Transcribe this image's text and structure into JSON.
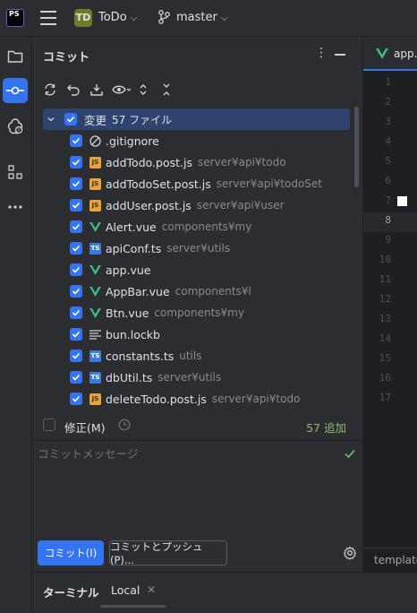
{
  "app": {
    "logo_text": "PS"
  },
  "titlebar": {
    "project_badge": "TD",
    "project_name": "ToDo",
    "branch": "master",
    "caret": "⌵"
  },
  "sidebar_strip": {
    "items": [
      {
        "name": "project-icon"
      },
      {
        "name": "commit-icon",
        "active": true
      },
      {
        "name": "ai-assistant-icon"
      },
      {
        "name": "structure-icon"
      },
      {
        "name": "more-icon"
      }
    ]
  },
  "commit_panel": {
    "title": "コミット",
    "menu_glyph": "⋮",
    "group": {
      "label": "変更",
      "count_text": "57 ファイル"
    },
    "files": [
      {
        "name": ".gitignore",
        "path": "",
        "icon": "ignore-icon"
      },
      {
        "name": "addTodo.post.js",
        "path": "server¥api¥todo",
        "icon": "js-icon"
      },
      {
        "name": "addTodoSet.post.js",
        "path": "server¥api¥todoSet",
        "icon": "js-icon"
      },
      {
        "name": "addUser.post.js",
        "path": "server¥api¥user",
        "icon": "js-icon"
      },
      {
        "name": "Alert.vue",
        "path": "components¥my",
        "icon": "vue-icon"
      },
      {
        "name": "apiConf.ts",
        "path": "server¥utils",
        "icon": "ts-icon"
      },
      {
        "name": "app.vue",
        "path": "",
        "icon": "vue-icon"
      },
      {
        "name": "AppBar.vue",
        "path": "components¥l",
        "icon": "vue-icon"
      },
      {
        "name": "Btn.vue",
        "path": "components¥my",
        "icon": "vue-icon"
      },
      {
        "name": "bun.lockb",
        "path": "",
        "icon": "text-file-icon"
      },
      {
        "name": "constants.ts",
        "path": "utils",
        "icon": "ts-icon"
      },
      {
        "name": "dbUtil.ts",
        "path": "server¥utils",
        "icon": "ts-icon"
      },
      {
        "name": "deleteTodo.post.js",
        "path": "server¥api¥todo",
        "icon": "js-icon"
      }
    ],
    "amend_label": "修正(M)",
    "added_text": "57 追加",
    "message_placeholder": "コミットメッセージ",
    "commit_button": "コミット(I)",
    "commit_push_button": "コミットとプッシュ(P)...",
    "icon_labels": {
      "js": "JS",
      "ts": "TS"
    }
  },
  "editor": {
    "tab_label": "app.",
    "line_numbers": [
      "1",
      "2",
      "3",
      "4",
      "5",
      "6",
      "7",
      "8",
      "9",
      "10",
      "11",
      "12",
      "13",
      "14",
      "15",
      "16",
      "17"
    ],
    "current_line": "8",
    "breadcrumb": "template"
  },
  "bottom_panel": {
    "title": "ターミナル",
    "tab_label": "Local",
    "close_glyph": "✕"
  },
  "colors": {
    "accent": "#3574f0",
    "added": "#8cbd6a",
    "selection": "#2e436e",
    "vue_green": "#41b883"
  }
}
